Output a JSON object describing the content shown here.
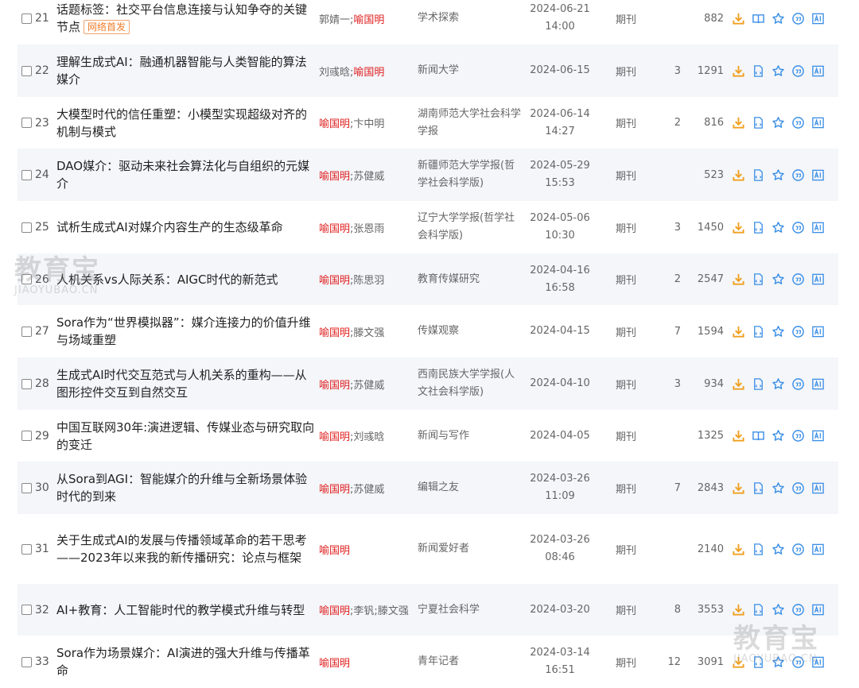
{
  "rows": [
    {
      "num": "21",
      "title": "话题标签：社交平台信息连接与认知争夺的关键节点",
      "tag": "网络首发",
      "authors": [
        {
          "name": "郭婧一",
          "hl": false
        },
        {
          "name": "喻国明",
          "hl": true
        }
      ],
      "source": "学术探索",
      "date": "2024-06-21",
      "time": "14:00",
      "type": "期刊",
      "cite": "",
      "downloads": "882",
      "read_icon": "book"
    },
    {
      "num": "22",
      "title": "理解生成式AI：融通机器智能与人类智能的算法媒介",
      "tag": "",
      "authors": [
        {
          "name": "刘彧晗",
          "hl": false
        },
        {
          "name": "喻国明",
          "hl": true
        }
      ],
      "source": "新闻大学",
      "date": "2024-06-15",
      "time": "",
      "type": "期刊",
      "cite": "3",
      "downloads": "1291",
      "read_icon": "html"
    },
    {
      "num": "23",
      "title": "大模型时代的信任重塑：小模型实现超级对齐的机制与模式",
      "tag": "",
      "authors": [
        {
          "name": "喻国明",
          "hl": true
        },
        {
          "name": "卞中明",
          "hl": false
        }
      ],
      "source": "湖南师范大学社会科学学报",
      "date": "2024-06-14",
      "time": "14:27",
      "type": "期刊",
      "cite": "2",
      "downloads": "816",
      "read_icon": "html"
    },
    {
      "num": "24",
      "title": "DAO媒介：驱动未来社会算法化与自组织的元媒介",
      "tag": "",
      "authors": [
        {
          "name": "喻国明",
          "hl": true
        },
        {
          "name": "苏健威",
          "hl": false
        }
      ],
      "source": "新疆师范大学学报(哲学社会科学版)",
      "date": "2024-05-29",
      "time": "15:53",
      "type": "期刊",
      "cite": "",
      "downloads": "523",
      "read_icon": "html"
    },
    {
      "num": "25",
      "title": "试析生成式AI对媒介内容生产的生态级革命",
      "tag": "",
      "authors": [
        {
          "name": "喻国明",
          "hl": true
        },
        {
          "name": "张恩雨",
          "hl": false
        }
      ],
      "source": "辽宁大学学报(哲学社会科学版)",
      "date": "2024-05-06",
      "time": "10:30",
      "type": "期刊",
      "cite": "3",
      "downloads": "1450",
      "read_icon": "html"
    },
    {
      "num": "26",
      "title": "人机关系vs人际关系：AIGC时代的新范式",
      "tag": "",
      "authors": [
        {
          "name": "喻国明",
          "hl": true
        },
        {
          "name": "陈思羽",
          "hl": false
        }
      ],
      "source": "教育传媒研究",
      "date": "2024-04-16",
      "time": "16:58",
      "type": "期刊",
      "cite": "2",
      "downloads": "2547",
      "read_icon": "html"
    },
    {
      "num": "27",
      "title": "Sora作为“世界模拟器”：媒介连接力的价值升维与场域重塑",
      "tag": "",
      "authors": [
        {
          "name": "喻国明",
          "hl": true
        },
        {
          "name": "滕文强",
          "hl": false
        }
      ],
      "source": "传媒观察",
      "date": "2024-04-15",
      "time": "",
      "type": "期刊",
      "cite": "7",
      "downloads": "1594",
      "read_icon": "html"
    },
    {
      "num": "28",
      "title": "生成式AI时代交互范式与人机关系的重构——从图形控件交互到自然交互",
      "tag": "",
      "authors": [
        {
          "name": "喻国明",
          "hl": true
        },
        {
          "name": "苏健威",
          "hl": false
        }
      ],
      "source": "西南民族大学学报(人文社会科学版)",
      "date": "2024-04-10",
      "time": "",
      "type": "期刊",
      "cite": "3",
      "downloads": "934",
      "read_icon": "html"
    },
    {
      "num": "29",
      "title": "中国互联网30年:演进逻辑、传媒业态与研究取向的变迁",
      "tag": "",
      "authors": [
        {
          "name": "喻国明",
          "hl": true
        },
        {
          "name": "刘彧晗",
          "hl": false
        }
      ],
      "source": "新闻与写作",
      "date": "2024-04-05",
      "time": "",
      "type": "期刊",
      "cite": "",
      "downloads": "1325",
      "read_icon": "book"
    },
    {
      "num": "30",
      "title": "从Sora到AGI：智能媒介的升维与全新场景体验时代的到来",
      "tag": "",
      "authors": [
        {
          "name": "喻国明",
          "hl": true
        },
        {
          "name": "苏健威",
          "hl": false
        }
      ],
      "source": "编辑之友",
      "date": "2024-03-26",
      "time": "11:09",
      "type": "期刊",
      "cite": "7",
      "downloads": "2843",
      "read_icon": "html"
    },
    {
      "num": "31",
      "title": "关于生成式AI的发展与传播领域革命的若干思考——2023年以来我的新传播研究：论点与框架",
      "tag": "",
      "authors": [
        {
          "name": "喻国明",
          "hl": true
        }
      ],
      "source": "新闻爱好者",
      "date": "2024-03-26",
      "time": "08:46",
      "type": "期刊",
      "cite": "",
      "downloads": "2140",
      "read_icon": "html"
    },
    {
      "num": "32",
      "title": "AI+教育：人工智能时代的教学模式升维与转型",
      "tag": "",
      "authors": [
        {
          "name": "喻国明",
          "hl": true
        },
        {
          "name": "李钒",
          "hl": false
        },
        {
          "name": "滕文强",
          "hl": false
        }
      ],
      "source": "宁夏社会科学",
      "date": "2024-03-20",
      "time": "",
      "type": "期刊",
      "cite": "8",
      "downloads": "3553",
      "read_icon": "html"
    },
    {
      "num": "33",
      "title": "Sora作为场景媒介：AI演进的强大升维与传播革命",
      "tag": "",
      "authors": [
        {
          "name": "喻国明",
          "hl": true
        }
      ],
      "source": "青年记者",
      "date": "2024-03-14",
      "time": "16:51",
      "type": "期刊",
      "cite": "12",
      "downloads": "3091",
      "read_icon": "html"
    }
  ],
  "ops_labels": {
    "download": "下载",
    "read": "阅读",
    "favorite": "收藏",
    "quote": "引用",
    "ai": "AI"
  },
  "watermark": {
    "text": "教育宝",
    "sub": "JIAOYUBAO.CN"
  },
  "colors": {
    "accent": "#3a8ee6",
    "highlight": "#e02020",
    "tag": "#f07d2a",
    "download": "#f0a020",
    "row_alt": "#f4f6fa"
  }
}
